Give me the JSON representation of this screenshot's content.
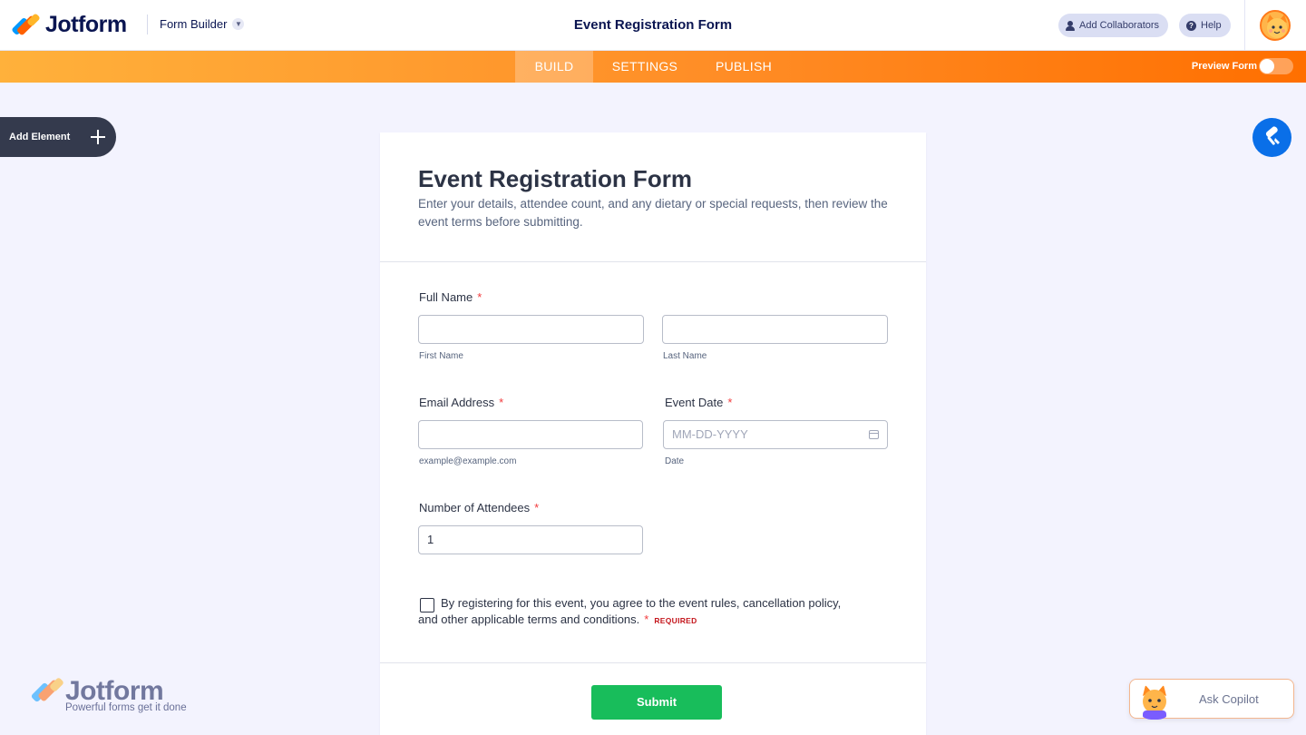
{
  "header": {
    "logo_text": "Jotform",
    "builder_menu": "Form Builder",
    "title": "Event Registration Form",
    "add_collaborators": "Add Collaborators",
    "help": "Help"
  },
  "nav": {
    "tabs": [
      {
        "label": "BUILD",
        "active": true
      },
      {
        "label": "SETTINGS",
        "active": false
      },
      {
        "label": "PUBLISH",
        "active": false
      }
    ],
    "preview_label": "Preview Form",
    "preview_enabled": false
  },
  "sidebar": {
    "add_element": "Add Element"
  },
  "form": {
    "title": "Event Registration Form",
    "description": "Enter your details, attendee count, and any dietary or special requests, then review the event terms before submitting.",
    "full_name": {
      "label": "Full Name",
      "first_sub": "First Name",
      "last_sub": "Last Name",
      "first_value": "",
      "last_value": ""
    },
    "email": {
      "label": "Email Address",
      "value": "",
      "sublabel": "example@example.com"
    },
    "event_date": {
      "label": "Event Date",
      "placeholder": "MM-DD-YYYY",
      "sublabel": "Date"
    },
    "attendees": {
      "label": "Number of Attendees",
      "value": "1"
    },
    "terms": {
      "text": "By registering for this event, you agree to the event rules, cancellation policy, and other applicable terms and conditions.",
      "required_tag": "REQUIRED",
      "checked": false
    },
    "required_mark": "*",
    "submit_label": "Submit"
  },
  "watermark": {
    "brand": "Jotform",
    "tagline": "Powerful forms get it done"
  },
  "copilot": {
    "label": "Ask Copilot"
  },
  "colors": {
    "brand_orange": "#ff6f00",
    "submit_green": "#18bd5b",
    "navy": "#0a1551",
    "required_red": "#f23a3c"
  }
}
